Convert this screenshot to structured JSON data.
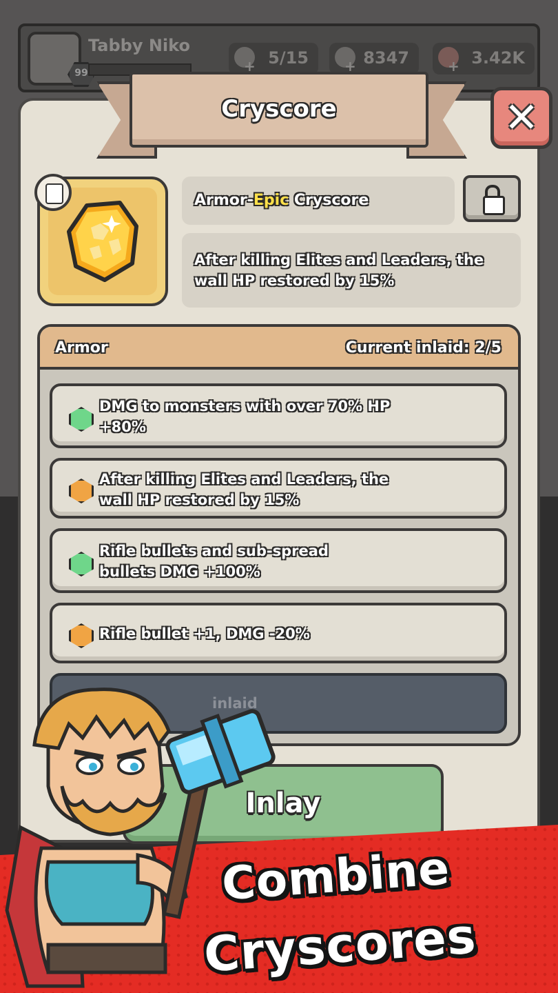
{
  "header": {
    "player_name": "Tabby Niko",
    "level": "99",
    "resources": [
      {
        "icon": "stone-icon",
        "value": "5/15"
      },
      {
        "icon": "ore-icon",
        "value": "8347"
      },
      {
        "icon": "crystal-ore-icon",
        "value": "3.42K"
      }
    ]
  },
  "modal": {
    "title": "Cryscore",
    "close_icon": "close-icon",
    "item": {
      "name_prefix": "Armor-",
      "rarity": "Epic",
      "name_suffix": " Cryscore",
      "description": "After killing Elites and Leaders, the wall HP restored by 15%",
      "type_icon": "armor-icon",
      "lock_icon": "lock-icon"
    },
    "slots": {
      "category": "Armor",
      "current_inlaid": "Current inlaid: 2/5",
      "items": [
        {
          "gem": "green",
          "text": "DMG to monsters with over 70% HP +80%"
        },
        {
          "gem": "orange",
          "text": "After killing Elites and Leaders, the wall HP restored by 15%"
        },
        {
          "gem": "green",
          "text": "Rifle bullets and sub-spread bullets DMG +100%"
        },
        {
          "gem": "orange",
          "text": "Rifle bullet +1, DMG -20%"
        }
      ],
      "empty_slot_text": "inlaid"
    },
    "inlay_button": "Inlay"
  },
  "promo": {
    "line1": "Combine",
    "line2": "Cryscores"
  },
  "colors": {
    "accent_epic": "#ffe04a",
    "banner_red": "#e42c24",
    "inlay_green": "#8fc08f"
  }
}
